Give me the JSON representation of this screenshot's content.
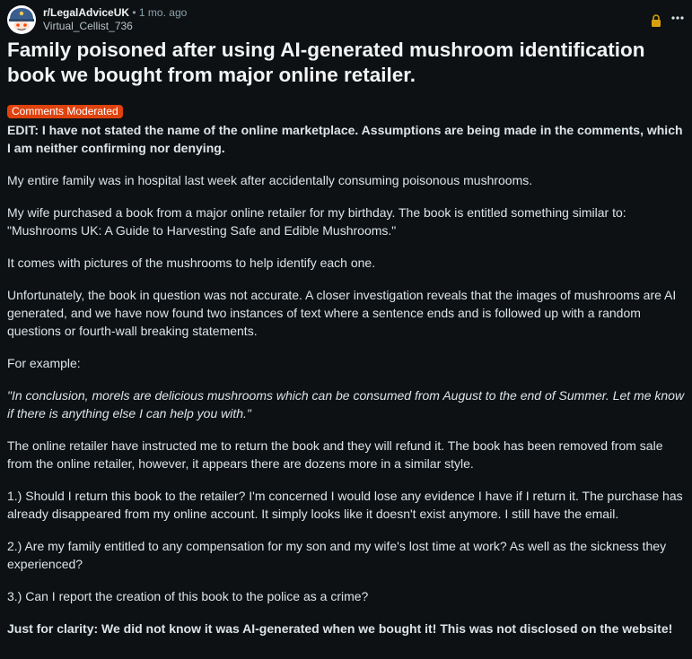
{
  "post": {
    "subreddit": "r/LegalAdviceUK",
    "separator": "•",
    "time_ago": "1 mo. ago",
    "author": "Virtual_Cellist_736",
    "title": "Family poisoned after using AI-generated mushroom identification book we bought from major online retailer.",
    "flair": "Comments Moderated",
    "flair_color": "#e0420e",
    "icons": {
      "avatar": "subreddit-avatar-icon",
      "lock": "lock-icon",
      "more": "more-options-icon"
    },
    "paragraphs": {
      "edit": "EDIT: I have not stated the name of the online marketplace. Assumptions are being made in the comments, which I am neither confirming nor denying.",
      "p1": "My entire family was in hospital last week after accidentally consuming poisonous mushrooms.",
      "p2": "My wife purchased a book from a major online retailer for my birthday. The book is entitled something similar to: \"Mushrooms UK: A Guide to Harvesting Safe and Edible Mushrooms.\"",
      "p3": "It comes with pictures of the mushrooms to help identify each one.",
      "p4": "Unfortunately, the book in question was not accurate. A closer investigation reveals that the images of mushrooms are AI generated, and we have now found two instances of text where a sentence ends and is followed up with a random questions or fourth-wall breaking statements.",
      "p5": "For example:",
      "quote": "\"In conclusion, morels are delicious mushrooms which can be consumed from August to the end of Summer. Let me know if there is anything else I can help you with.\"",
      "p6": "The online retailer have instructed me to return the book and they will refund it. The book has been removed from sale from the online retailer, however, it appears there are dozens more in a similar style.",
      "q1": "1.) Should I return this book to the retailer? I'm concerned I would lose any evidence I have if I return it. The purchase has already disappeared from my online account. It simply looks like it doesn't exist anymore. I still have the email.",
      "q2": "2.) Are my family entitled to any compensation for my son and my wife's lost time at work? As well as the sickness they experienced?",
      "q3": "3.) Can I report the creation of this book to the police as a crime?",
      "clarity": "Just for clarity: We did not know it was AI-generated when we bought it! This was not disclosed on the website!"
    }
  }
}
